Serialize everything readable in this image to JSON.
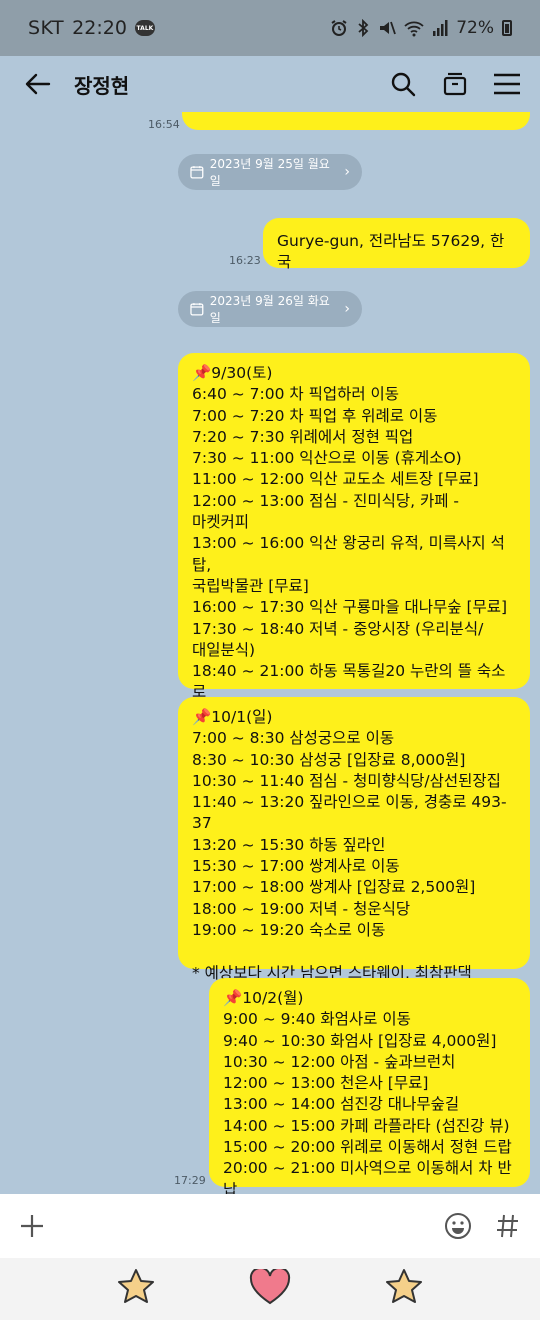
{
  "status_bar": {
    "carrier": "SKT",
    "time": "22:20",
    "talk_badge": "TALK",
    "battery": "72%"
  },
  "header": {
    "title": "장정현"
  },
  "messages": {
    "top_time": "16:54",
    "date1": "2023년 9월 25일 월요일",
    "msg1_text": "Gurye-gun, 전라남도 57629, 한국",
    "msg1_time": "16:23",
    "date2": "2023년 9월 26일 화요일",
    "msg2_text": "📌9/30(토)\n6:40 ~ 7:00 차 픽업하러 이동\n7:00 ~ 7:20 차 픽업 후 위례로 이동\n7:20 ~ 7:30 위례에서 정현 픽업\n7:30 ~ 11:00 익산으로 이동 (휴게소O)\n11:00 ~ 12:00 익산 교도소 세트장 [무료]\n12:00 ~ 13:00 점심 - 진미식당, 카페 -\n마켓커피\n13:00 ~ 16:00 익산 왕궁리 유적, 미륵사지 석탑,\n국립박물관 [무료]\n16:00 ~ 17:30 익산 구룡마을 대나무숲 [무료]\n17:30 ~ 18:40 저녁 - 중앙시장 (우리분식/\n대일분식)\n18:40 ~ 21:00 하동 목통길20 누란의 뜰 숙소로\n이동",
    "msg3_text": "📌10/1(일)\n7:00 ~ 8:30 삼성궁으로 이동\n8:30 ~ 10:30 삼성궁 [입장료 8,000원]\n10:30 ~ 11:40 점심 - 청미향식당/삼선된장집\n11:40 ~ 13:20 짚라인으로 이동, 경충로 493-37\n13:20 ~ 15:30 하동 짚라인\n15:30 ~ 17:00 쌍계사로 이동\n17:00 ~ 18:00 쌍계사 [입장료 2,500원]\n18:00 ~ 19:00 저녁 - 청운식당\n19:00 ~ 19:20 숙소로 이동\n\n* 예상보다 시간 남으면 스타웨이, 최참판댁",
    "msg4_text": "📌10/2(월)\n9:00 ~ 9:40 화엄사로 이동\n9:40 ~ 10:30 화엄사 [입장료 4,000원]\n10:30 ~ 12:00 아점 - 숲과브런치\n12:00 ~ 13:00 천은사 [무료]\n13:00 ~ 14:00 섬진강 대나무숲길\n14:00 ~ 15:00 카페 라플라타 (섬진강 뷰)\n15:00 ~ 20:00 위례로 이동해서 정현 드랍\n20:00 ~ 21:00 미사역으로 이동해서 차 반납",
    "msg4_time": "17:29"
  },
  "colors": {
    "background": "#b2c7d9",
    "bubble_yellow": "#fef01b",
    "date_pill": "#9aaebf"
  }
}
